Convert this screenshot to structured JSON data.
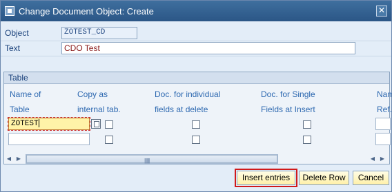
{
  "window": {
    "title": "Change Document Object: Create",
    "close_glyph": "✕"
  },
  "form": {
    "object_label": "Object",
    "object_value": "ZOTEST_CD",
    "text_label": "Text",
    "text_value": "CDO Test"
  },
  "table": {
    "title": "Table",
    "columns": [
      {
        "line1": "Name of",
        "line2": "Table"
      },
      {
        "line1": "Copy as",
        "line2": "internal tab."
      },
      {
        "line1": "Doc. for individual",
        "line2": "fields at delete"
      },
      {
        "line1": "Doc. for Single",
        "line2": "Fields at Insert"
      },
      {
        "line1": "Nam",
        "line2": "Ref."
      }
    ],
    "rows": [
      {
        "table_name": "ZOTEST"
      },
      {
        "table_name": ""
      }
    ]
  },
  "buttons": {
    "insert_entries": "Insert entries",
    "delete_row": "Delete Row",
    "cancel": "Cancel"
  },
  "scroll": {
    "left_glyph": "◀",
    "right_glyph": "▶",
    "grip_glyph": "|||||||"
  },
  "colors": {
    "title_bar": "#2b5686",
    "label_text": "#19407a",
    "column_header_text": "#2d68b0",
    "button_bg": "#fff0a8",
    "highlight_outline": "#d11a1a"
  }
}
